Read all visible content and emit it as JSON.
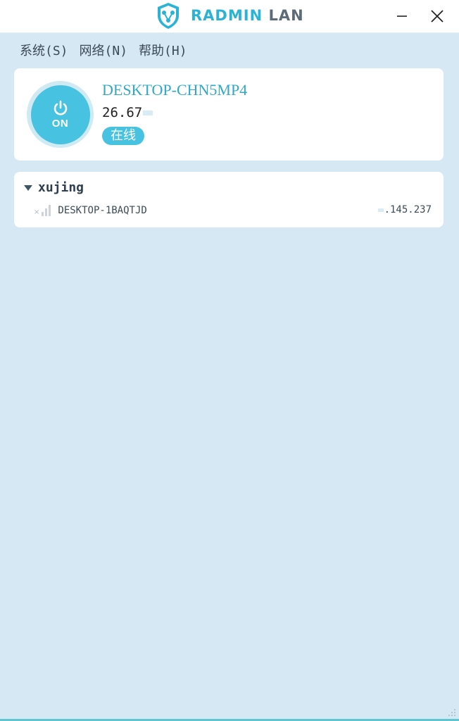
{
  "app": {
    "logo_text_first": "RADMIN",
    "logo_text_second": "LAN"
  },
  "window": {
    "minimize_label": "—",
    "close_label": "✕"
  },
  "menu": [
    {
      "label": "系统(S)"
    },
    {
      "label": "网络(N)"
    },
    {
      "label": "帮助(H)"
    }
  ],
  "local": {
    "power_state": "ON",
    "hostname": "DESKTOP-CHN5MP4",
    "ip_visible": "26.67",
    "status": "在线"
  },
  "network": {
    "name": "xujing",
    "expanded": true,
    "peers": [
      {
        "name": "DESKTOP-1BAQTJD",
        "ip_visible": ".145.237",
        "signal": "offline"
      }
    ]
  },
  "colors": {
    "accent": "#47c2e0",
    "hostname": "#2fa9c6",
    "background": "#d5e8f4"
  }
}
